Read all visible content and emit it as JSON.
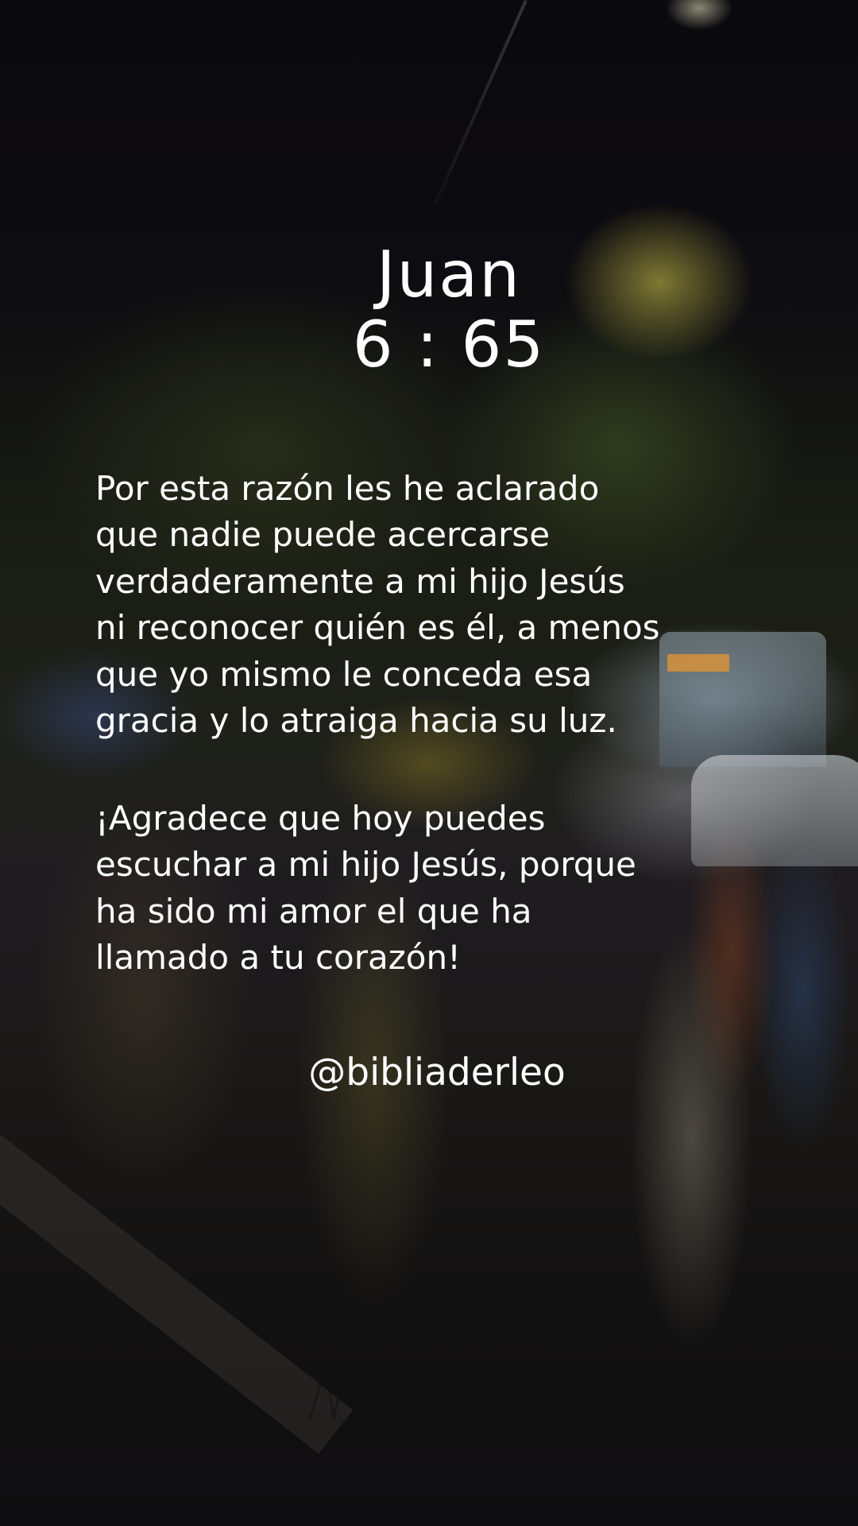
{
  "reference": {
    "book": "Juan",
    "chapter_verse": "6 : 65"
  },
  "verse_lines": [
    "Por esta razón les he aclarado",
    "que nadie puede acercarse",
    "verdaderamente a mi hijo Jesús",
    "ni reconocer quién es él, a menos",
    "que yo mismo le conceda esa",
    "gracia y lo atraiga hacia su luz."
  ],
  "closing_lines": [
    "¡Agradece que hoy puedes",
    "escuchar a mi hijo Jesús, porque",
    "ha sido mi amor el que ha",
    "llamado a tu corazón!"
  ],
  "handle": "@bibliaderleo",
  "colors": {
    "text": "#ffffff",
    "background": "#0b0a0d",
    "streetlight": "#dcd250",
    "bus_sign": "#e69632"
  }
}
